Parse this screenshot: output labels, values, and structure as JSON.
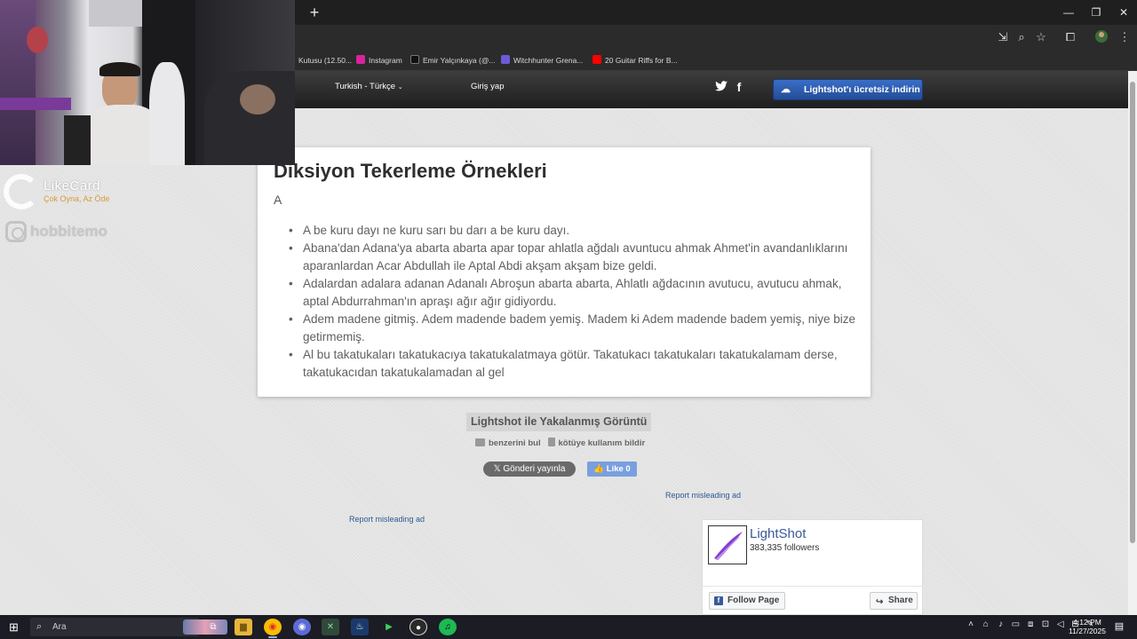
{
  "browser": {
    "new_tab": "+",
    "window_controls": {
      "minimize": "—",
      "restore": "❐",
      "close": "✕"
    },
    "toolbar_icons": [
      "install-app-icon",
      "zoom-icon",
      "star-icon",
      "extensions-icon",
      "profile-icon",
      "menu-icon"
    ],
    "bookmarks": [
      {
        "label": "Kutusu (12.50...",
        "icon": "bookmark-icon",
        "color": "#5a5a5a"
      },
      {
        "label": "Instagram",
        "icon": "instagram-icon",
        "color": "#d6249f"
      },
      {
        "label": "Emir Yalçınkaya (@...",
        "icon": "x-icon",
        "color": "#000000"
      },
      {
        "label": "Witchhunter Grena...",
        "icon": "shield-icon",
        "color": "#6b5bd6"
      },
      {
        "label": "20 Guitar Riffs for B...",
        "icon": "youtube-icon",
        "color": "#ff0000"
      }
    ]
  },
  "lightshot_header": {
    "language": "Turkish - Türkçe",
    "login": "Giriş yap",
    "download_button": "Lightshot'ı ücretsiz indirin"
  },
  "document": {
    "title": "Diksiyon Tekerleme Örnekleri",
    "letter": "A",
    "items": [
      "A be kuru dayı ne kuru sarı bu darı a be kuru dayı.",
      "Abana'dan Adana'ya abarta abarta apar topar ahlatla ağdalı avuntucu ahmak Ahmet'in avandanlıklarını aparanlardan Acar Abdullah ile Aptal Abdi akşam akşam bize geldi.",
      "Adalardan adalara adanan Adanalı Abroşun abarta abarta, Ahlatlı ağdacının avutucu, avutucu ahmak, aptal Abdurrahman'ın apraşı ağır ağır gidiyordu.",
      "Adem madene gitmiş. Adem madende badem yemiş. Madem ki Adem madende badem yemiş, niye bize getirmemiş.",
      "Al bu takatukaları takatukacıya takatukalatmaya götür. Takatukacı takatukaları takatukalamam derse, takatukacıdan takatukalamadan al gel"
    ]
  },
  "caption": {
    "title": "Lightshot ile Yakalanmış Görüntü",
    "find_similar": "benzerini bul",
    "report_abuse": "kötüye kullanım bildir",
    "tweet": "𝕏 Gönderi yayınla",
    "like": "👍 Like 0"
  },
  "ads": {
    "report_right": "Report misleading ad",
    "report_left": "Report misleading ad"
  },
  "fb_widget": {
    "name": "LightShot",
    "followers": "383,335 followers",
    "follow": "Follow Page",
    "share": "Share"
  },
  "overlay": {
    "likecard_name": "LikeCard",
    "likecard_slogan": "Çok Oyna, Az Öde",
    "instagram": "hobbitemo"
  },
  "taskbar": {
    "search_placeholder": "Ara",
    "time": "4:12 PM",
    "date": "11/27/2025",
    "apps": [
      {
        "name": "task-view-icon",
        "color": "#3a3a44",
        "glyph": "⧉"
      },
      {
        "name": "file-explorer-icon",
        "color": "#e8b53a",
        "glyph": "▆"
      },
      {
        "name": "chrome-icon",
        "color": "#e53935",
        "glyph": "◉"
      },
      {
        "name": "chrome-profile-icon",
        "color": "#5d6bd6",
        "glyph": "◉"
      },
      {
        "name": "xbox-icon",
        "color": "#2f6b3a",
        "glyph": "✕"
      },
      {
        "name": "steam-icon",
        "color": "#1b3a6b",
        "glyph": "♨"
      },
      {
        "name": "play-icon",
        "color": "#1c8f2a",
        "glyph": "▶"
      },
      {
        "name": "obs-icon",
        "color": "#2a2a2a",
        "glyph": "●"
      },
      {
        "name": "spotify-icon",
        "color": "#1db954",
        "glyph": "♫"
      }
    ]
  }
}
